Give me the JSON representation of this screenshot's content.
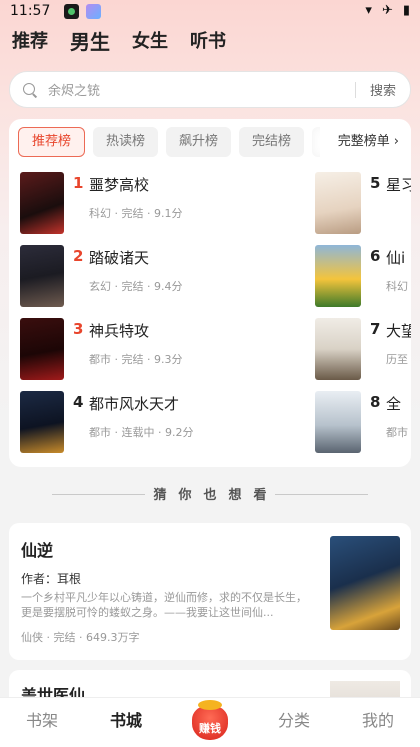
{
  "status_bar": {
    "time": "11:57",
    "icons": [
      "wifi-icon",
      "airplane-icon",
      "battery-icon"
    ]
  },
  "categories": [
    "推荐",
    "男生",
    "女生",
    "听书"
  ],
  "search": {
    "placeholder": "余烬之铳",
    "button": "搜索"
  },
  "rank_tabs": [
    "推荐榜",
    "热读榜",
    "飙升榜",
    "完结榜"
  ],
  "full_list_label": "完整榜单",
  "rankings": [
    {
      "rank": "1",
      "title": "噩梦高校",
      "meta": "科幻 · 完结 · 9.1分"
    },
    {
      "rank": "2",
      "title": "踏破诸天",
      "meta": "玄幻 · 完结 · 9.4分"
    },
    {
      "rank": "3",
      "title": "神兵特攻",
      "meta": "都市 · 完结 · 9.3分"
    },
    {
      "rank": "4",
      "title": "都市风水天才",
      "meta": "都市 · 连载中 · 9.2分"
    },
    {
      "rank": "5",
      "title": "星习",
      "meta": ""
    },
    {
      "rank": "6",
      "title": "仙i",
      "meta": "科幻"
    },
    {
      "rank": "7",
      "title": "大望",
      "meta": "历至"
    },
    {
      "rank": "8",
      "title": "全",
      "meta": "都市"
    }
  ],
  "guess_title": "猜你也想看",
  "recommendations": [
    {
      "title": "仙逆",
      "author": "作者：耳根",
      "description": "一个乡村平凡少年以心铸道，逆仙而修，求的不仅是长生，更是要摆脱可怜的蝼蚁之身。——我要让这世间仙...",
      "meta": "仙侠 · 完结 · 649.3万字"
    },
    {
      "title": "盖世医仙"
    }
  ],
  "bottom_nav": {
    "bookshelf": "书架",
    "store": "书城",
    "earn": "赚钱",
    "category": "分类",
    "mine": "我的"
  },
  "colors": {
    "accent": "#e8452c",
    "background": "#f3f3f3",
    "header_gradient": "#fbd6d2"
  }
}
